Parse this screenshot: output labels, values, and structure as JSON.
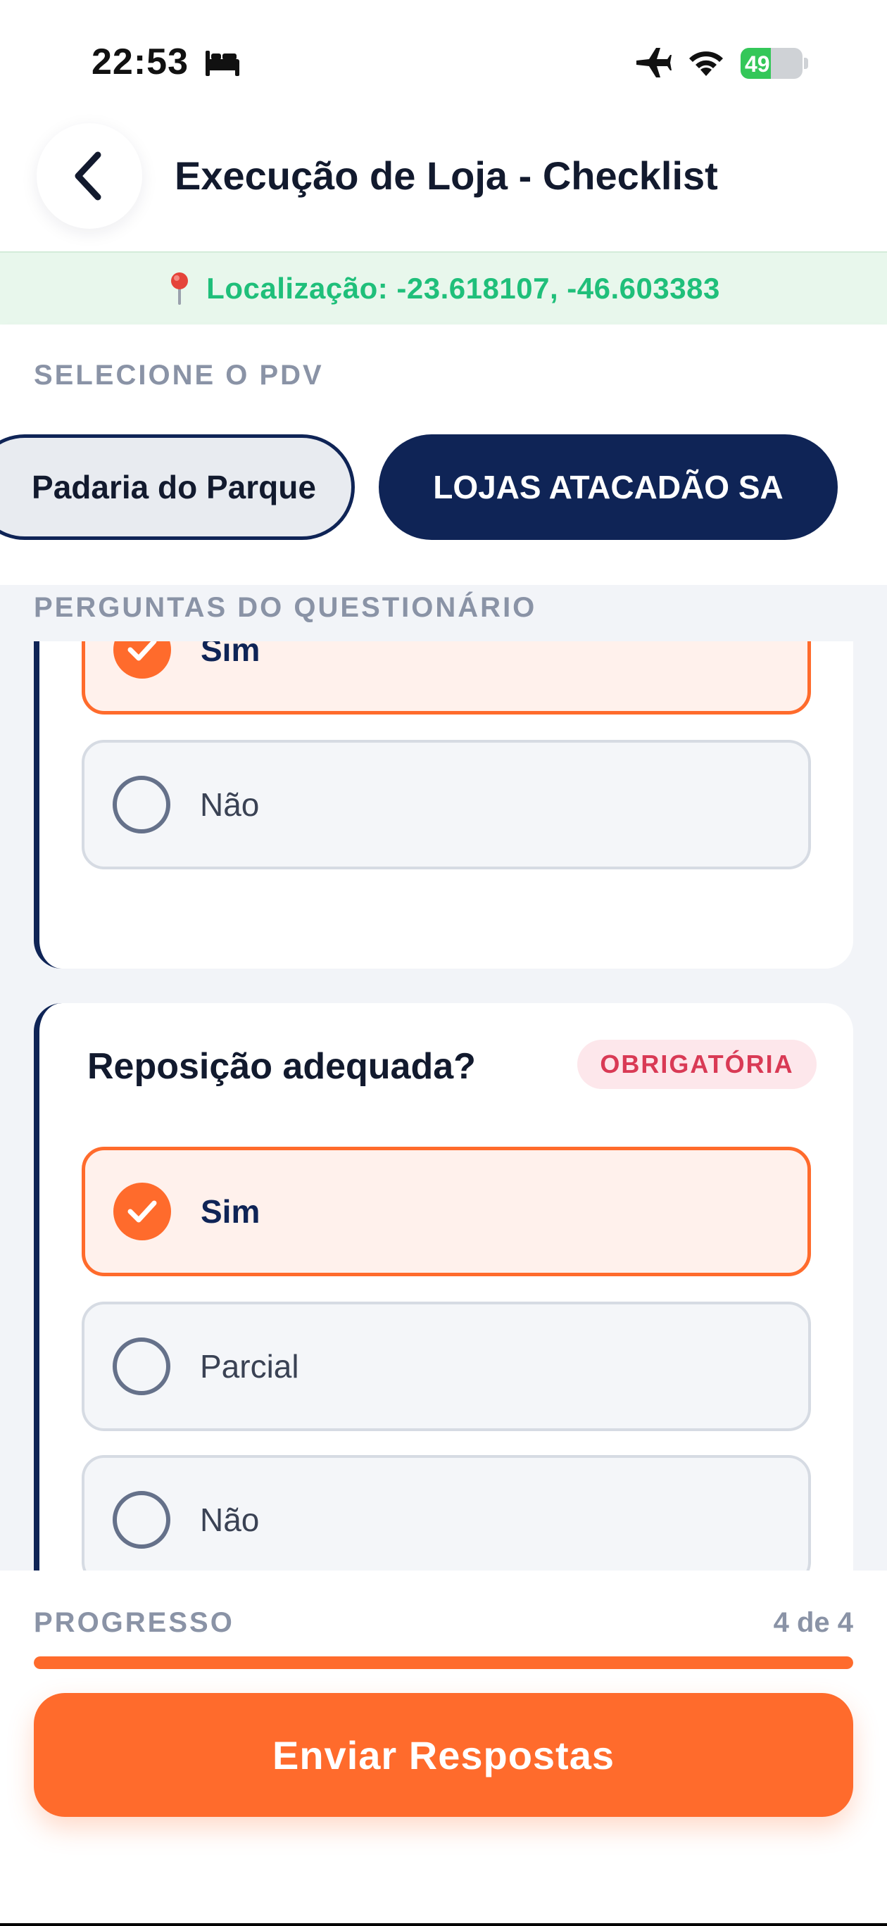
{
  "status_bar": {
    "time": "22:53",
    "battery_level": "49",
    "battery_fraction": 0.49
  },
  "header": {
    "title": "Execução de Loja - Checklist"
  },
  "location": {
    "text": "Localização: -23.618107, -46.603383"
  },
  "pdv": {
    "section_label": "SELECIONE O PDV",
    "options": [
      {
        "label": "Padaria do Parque",
        "selected": false
      },
      {
        "label": "LOJAS ATACADÃO SA",
        "selected": true
      }
    ]
  },
  "questions": {
    "section_label": "PERGUNTAS DO QUESTIONÁRIO",
    "items": [
      {
        "title": "",
        "options": [
          {
            "label": "Sim",
            "selected": true
          },
          {
            "label": "Não",
            "selected": false
          }
        ]
      },
      {
        "title": "Reposição adequada?",
        "badge": "OBRIGATÓRIA",
        "options": [
          {
            "label": "Sim",
            "selected": true
          },
          {
            "label": "Parcial",
            "selected": false
          },
          {
            "label": "Não",
            "selected": false
          }
        ]
      }
    ]
  },
  "progress": {
    "label": "PROGRESSO",
    "count": "4 de 4",
    "fraction": 1.0
  },
  "submit": {
    "label": "Enviar Respostas"
  },
  "colors": {
    "accent": "#ff6b2c",
    "primary": "#0f2456",
    "success_text": "#1fbf7a",
    "danger": "#d93a55"
  }
}
